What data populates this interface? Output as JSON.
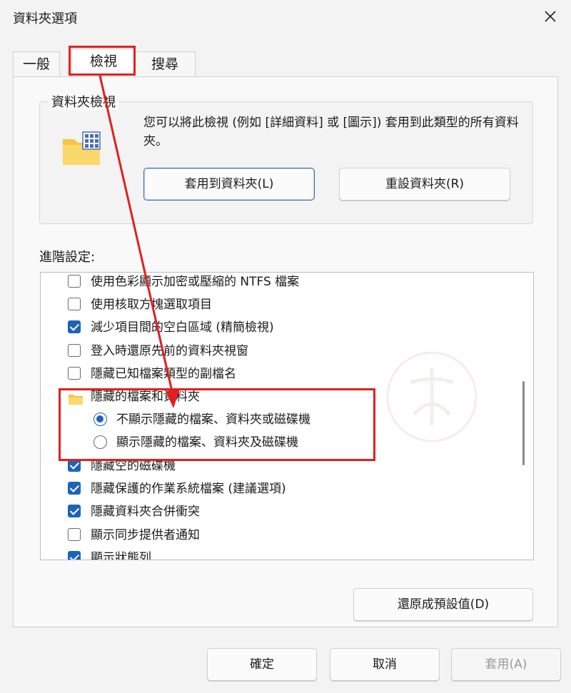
{
  "window": {
    "title": "資料夾選項"
  },
  "tabs": [
    {
      "label": "一般"
    },
    {
      "label": "檢視"
    },
    {
      "label": "搜尋"
    }
  ],
  "folder_views": {
    "title": "資料夾檢視",
    "description": "您可以將此檢視 (例如 [詳細資料] 或 [圖示]) 套用到此類型的所有資料夾。",
    "apply_button": "套用到資料夾(L)",
    "reset_button": "重設資料夾(R)"
  },
  "advanced": {
    "label": "進階設定:",
    "items": [
      {
        "type": "checkbox",
        "checked": false,
        "label": "使用色彩顯示加密或壓縮的 NTFS 檔案"
      },
      {
        "type": "checkbox",
        "checked": false,
        "label": "使用核取方塊選取項目"
      },
      {
        "type": "checkbox",
        "checked": true,
        "label": "減少項目間的空白區域 (精簡檢視)"
      },
      {
        "type": "checkbox",
        "checked": false,
        "label": "登入時還原先前的資料夾視窗"
      },
      {
        "type": "checkbox",
        "checked": false,
        "label": "隱藏已知檔案類型的副檔名"
      },
      {
        "type": "folder",
        "label": "隱藏的檔案和資料夾"
      },
      {
        "type": "radio",
        "checked": true,
        "label": "不顯示隱藏的檔案、資料夾或磁碟機"
      },
      {
        "type": "radio",
        "checked": false,
        "label": "顯示隱藏的檔案、資料夾及磁碟機"
      },
      {
        "type": "checkbox",
        "checked": true,
        "label": "隱藏空的磁碟機"
      },
      {
        "type": "checkbox",
        "checked": true,
        "label": "隱藏保護的作業系統檔案 (建議選項)"
      },
      {
        "type": "checkbox",
        "checked": true,
        "label": "隱藏資料夾合併衝突"
      },
      {
        "type": "checkbox",
        "checked": false,
        "label": "顯示同步提供者通知"
      },
      {
        "type": "checkbox",
        "checked": true,
        "label": "顯示狀態列"
      }
    ],
    "restore_button": "還原成預設值(D)"
  },
  "footer": {
    "ok": "確定",
    "cancel": "取消",
    "apply": "套用(A)"
  },
  "colors": {
    "accent": "#1d63b8",
    "annotation": "#e02020"
  }
}
